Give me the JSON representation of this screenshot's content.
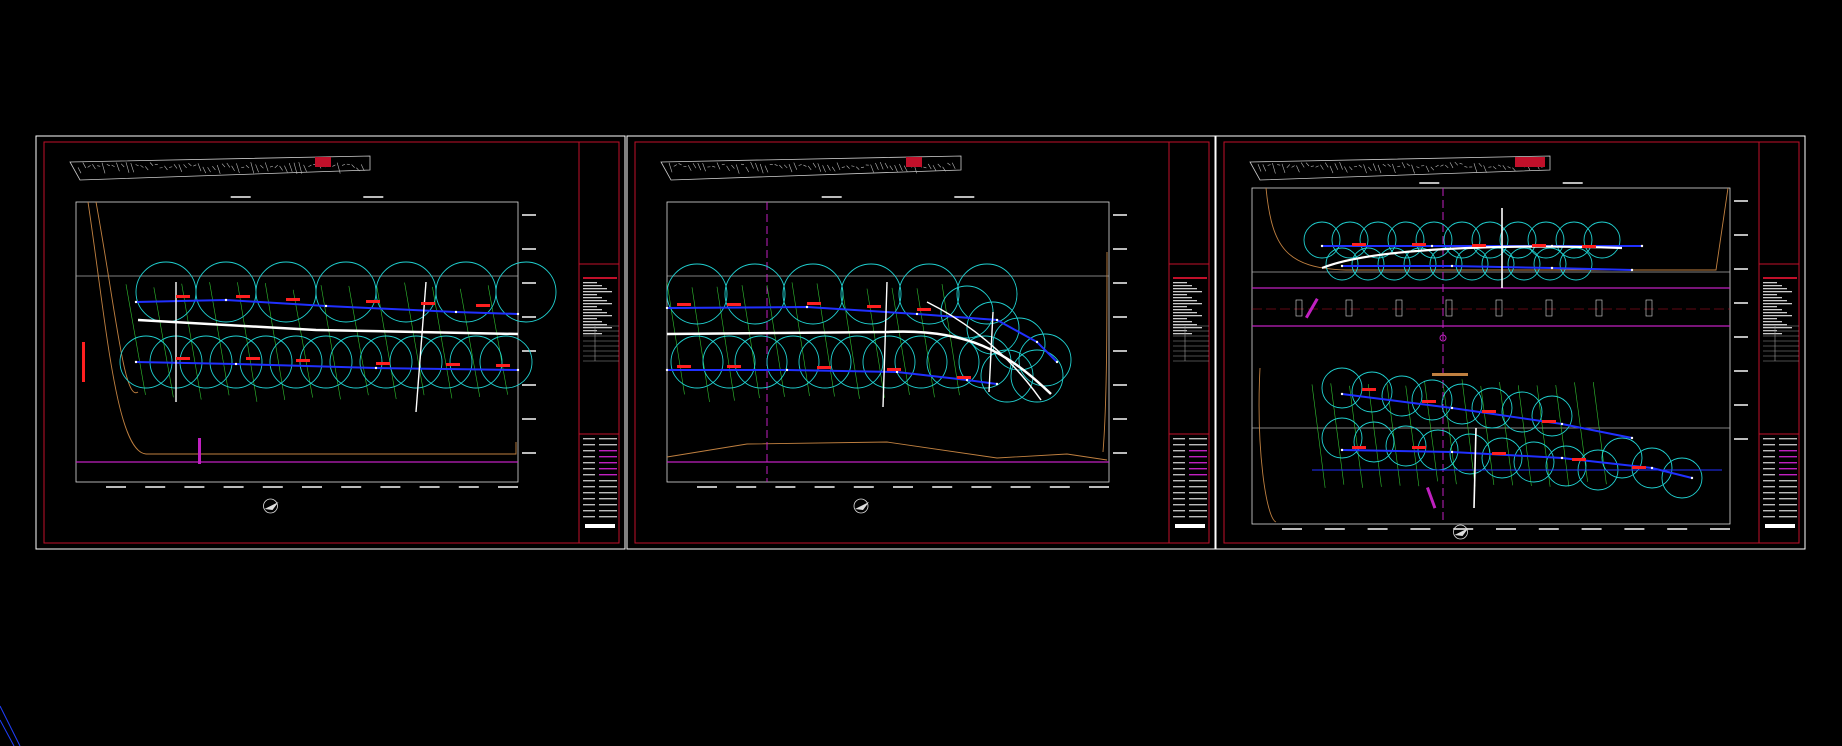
{
  "colors": {
    "background": "#000000",
    "sheet_border": "#ffffff",
    "frame_red": "#c0102a",
    "pipe_blue": "#2030ff",
    "circle_cyan": "#20d0d0",
    "label_red": "#ff2020",
    "road_white": "#ffffff",
    "boundary_tan": "#c08040",
    "magenta": "#c020c0",
    "green": "#30c030",
    "grid_gray": "#bbbbbb"
  },
  "sheets": [
    {
      "id": "sheet-1"
    },
    {
      "id": "sheet-2"
    },
    {
      "id": "sheet-3"
    }
  ],
  "ucs_icon": "ucs-axis-icon"
}
